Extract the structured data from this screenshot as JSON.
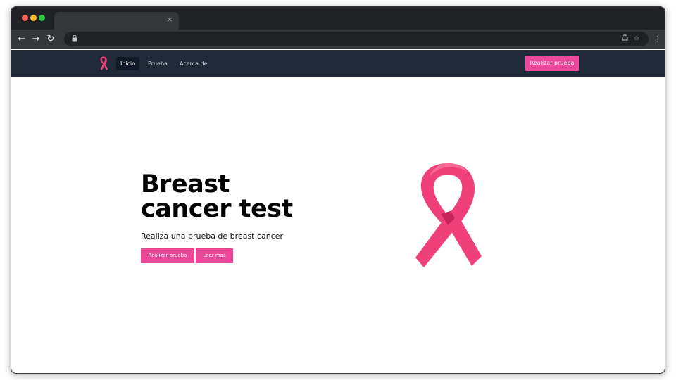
{
  "browser": {
    "tab": {
      "close_glyph": "×"
    },
    "toolbar": {
      "back_icon": "arrow-left-icon",
      "forward_icon": "arrow-right-icon",
      "reload_icon": "reload-icon",
      "lock_icon": "lock-icon",
      "share_icon": "share-icon",
      "bookmark_icon": "star-icon",
      "menu_icon": "kebab-menu-icon"
    }
  },
  "nav": {
    "logo_icon": "pink-ribbon-icon",
    "links": [
      "Inicio",
      "Prueba",
      "Acerca de"
    ],
    "active_link": "Inicio",
    "cta_label": "Realizar prueba"
  },
  "hero": {
    "title": "Breast cancer test",
    "subtitle": "Realiza una prueba de breast cancer",
    "primary_button": "Realizar prueba",
    "secondary_button": "Leer mas",
    "illustration": "pink-ribbon-icon"
  },
  "colors": {
    "nav_bg": "#1f2937",
    "accent": "#ec4899",
    "ribbon_pink": "#f0407a",
    "ribbon_shadow": "#c7245c"
  }
}
